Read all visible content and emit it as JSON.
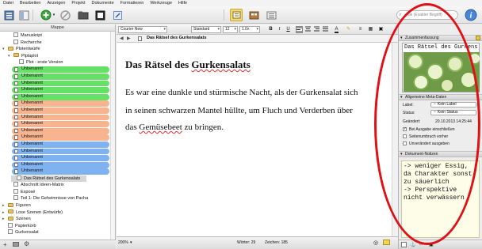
{
  "menu": [
    "Datei",
    "Bearbeiten",
    "Anzeigen",
    "Projekt",
    "Dokumente",
    "Formatieren",
    "Werkzeuge",
    "Hilfe"
  ],
  "toolbar": {
    "search_placeholder": "Alle (Exakter Begriff)",
    "icons": [
      "binder-icon",
      "inspector-toggle-icon",
      "add-icon",
      "delete-icon",
      "folder-icon",
      "compose-icon",
      "view-scrivenings-icon",
      "view-corkboard-icon",
      "view-outline-icon",
      "inspector-info-icon"
    ]
  },
  "binder": {
    "header": "Mappe",
    "items": [
      {
        "label": "Manuskript",
        "indent": 1,
        "kind": "doc"
      },
      {
        "label": "Recherche",
        "indent": 1,
        "kind": "doc"
      },
      {
        "label": "Plotentwürfe",
        "indent": 0,
        "kind": "folder",
        "open": true
      },
      {
        "label": "Plplaplot",
        "indent": 1,
        "kind": "folder",
        "open": true
      },
      {
        "label": "Plot - erste Version",
        "indent": 2,
        "kind": "doc"
      }
    ],
    "unbenannt": [
      {
        "label": "Unbenannt",
        "color": "#66e066"
      },
      {
        "label": "Unbenannt",
        "color": "#66e066"
      },
      {
        "label": "Unbenannt",
        "color": "#66e066"
      },
      {
        "label": "Unbenannt",
        "color": "#66e066"
      },
      {
        "label": "Unbenannt",
        "color": "#66e066"
      },
      {
        "label": "Unbenannt",
        "color": "#f7b48e"
      },
      {
        "label": "Unbenannt",
        "color": "#f7b48e"
      },
      {
        "label": "Unbenannt",
        "color": "#f7b48e"
      },
      {
        "label": "Unbenannt",
        "color": "#f7b48e"
      },
      {
        "label": "Unbenannt",
        "color": "#f7b48e"
      },
      {
        "label": "Unbenannt",
        "color": "#f7b48e"
      },
      {
        "label": "Unbenannt",
        "color": "#7fb2f0"
      },
      {
        "label": "Unbenannt",
        "color": "#7fb2f0"
      },
      {
        "label": "Unbenannt",
        "color": "#7fb2f0"
      },
      {
        "label": "Unbenannt",
        "color": "#7fb2f0"
      },
      {
        "label": "Unbenannt",
        "color": "#7fb2f0"
      }
    ],
    "items_after": [
      {
        "label": "Das Rätsel des Gurkensalats",
        "indent": 2,
        "kind": "doc",
        "selected": true
      },
      {
        "label": "Abschnitt Ideen-Matrix",
        "indent": 1,
        "kind": "doc"
      },
      {
        "label": "Exposé",
        "indent": 1,
        "kind": "doc"
      },
      {
        "label": "Teil 1: Die Geheimnisse von Pacha",
        "indent": 1,
        "kind": "doc"
      },
      {
        "label": "Figuren",
        "indent": 0,
        "kind": "folder"
      },
      {
        "label": "Lose Szenen (Entwürfe)",
        "indent": 0,
        "kind": "folder"
      },
      {
        "label": "Szenen",
        "indent": 0,
        "kind": "folder"
      },
      {
        "label": "Papierkorb",
        "indent": 0,
        "kind": "doc"
      },
      {
        "label": "Gurkensalat",
        "indent": 0,
        "kind": "doc"
      }
    ]
  },
  "format": {
    "font": "Courier New",
    "style": "Standard",
    "size": "12",
    "spacing": "1.0x",
    "bold": "B",
    "italic": "I",
    "underline": "U"
  },
  "editor": {
    "header_title": "Das Rätsel des Gurkensalats",
    "doc_title_prefix": "Das Rätsel des ",
    "doc_title_word": "Gurkensalats",
    "line1": "Es war eine dunkle und stürmische Nacht, als der Gurkensalat sich",
    "line2": "in seinen schwarzen Mantel hüllte, um Fluch und Verderben über",
    "line3_pre": "das ",
    "line3_word": "Gemüsebeet",
    "line3_post": " zu bringen."
  },
  "footer": {
    "zoom": "200%",
    "words_label": "Wörter: 29",
    "chars_label": "Zeichen: 185"
  },
  "inspector": {
    "summary_header": "Zusammenfassung",
    "image_caption": "Das Rätsel des Gurkens...",
    "meta_header": "Allgemeine Meta-Daten",
    "label_key": "Label:",
    "label_val": "Kein Label",
    "status_key": "Status:",
    "status_val": "Kein Status",
    "modified_key": "Geändert:",
    "modified_val": "20.10.2013 14:25:44",
    "check1": "Bei Ausgabe einschließen",
    "check2": "Seitenumbruch vorher",
    "check3": "Unverändert ausgeben",
    "notes_header": "Dokument-Notizen",
    "notes_text": "-> weniger Essig,\nda Charakter sonst\nzu säuerlich\n-> Perspektive\nnicht verwässern"
  },
  "colors": {
    "highlight_ring": "#e10f16",
    "green_label": "#66e066",
    "orange_label": "#f7b48e",
    "blue_label": "#7fb2f0"
  }
}
